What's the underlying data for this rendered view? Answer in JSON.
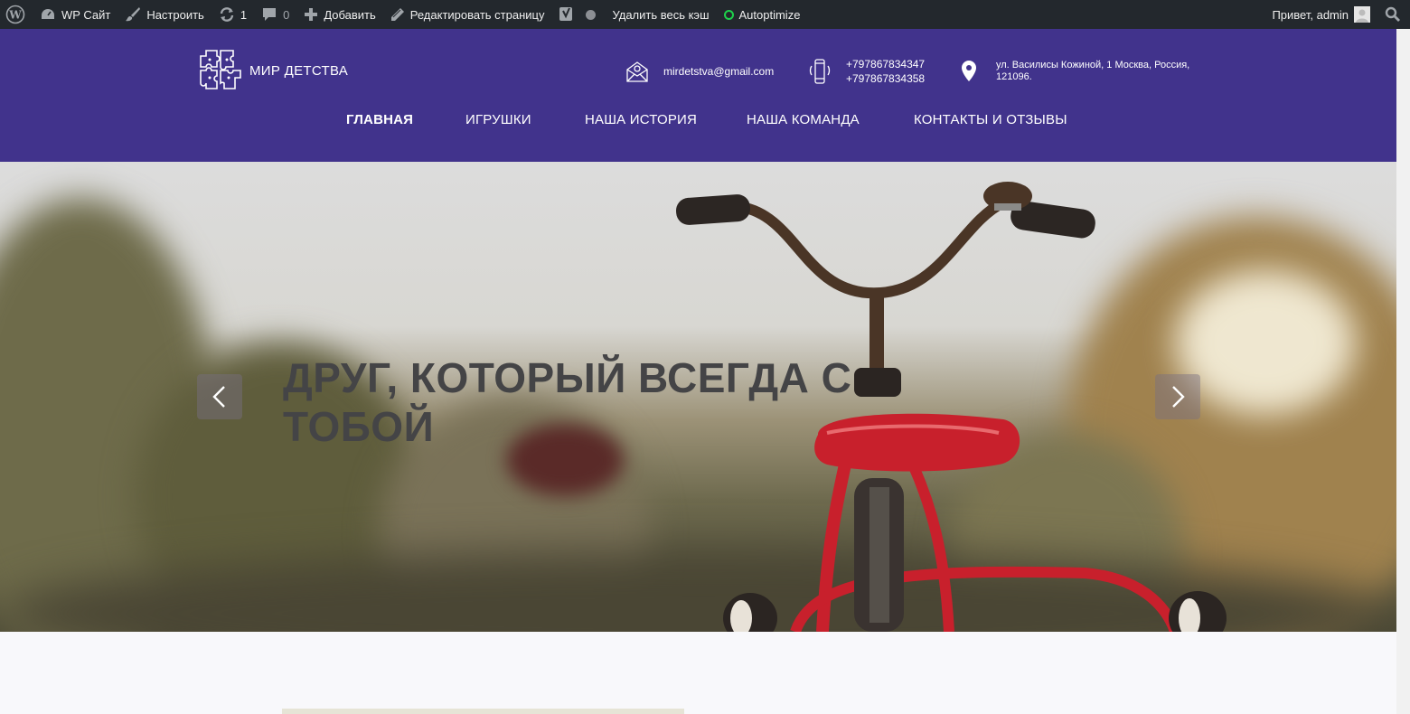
{
  "adminbar": {
    "site_name": "WP Сайт",
    "customize": "Настроить",
    "updates_count": "1",
    "comments_count": "0",
    "add_new": "Добавить",
    "edit_page": "Редактировать страницу",
    "clear_cache": "Удалить весь кэш",
    "autoptimize": "Autoptimize",
    "greeting": "Привет, admin"
  },
  "header": {
    "logo_text": "МИР ДЕТСТВА",
    "email": "mirdetstva@gmail.com",
    "phone1": "+797867834347",
    "phone2": "+797867834358",
    "address_line1": "ул. Василисы Кожиной, 1 Москва, Россия,",
    "address_line2": "121096."
  },
  "nav": {
    "items": [
      {
        "label": "Главная"
      },
      {
        "label": "Игрушки"
      },
      {
        "label": "Наша история"
      },
      {
        "label": "Наша команда"
      },
      {
        "label": "Контакты и отзывы"
      }
    ]
  },
  "hero": {
    "title_line1": "Друг, который всегда с",
    "title_line2": "тобой"
  },
  "colors": {
    "adminbar_bg": "#23282d",
    "header_bg": "#41338c",
    "hero_title": "#444446",
    "bike_red": "#c8202c"
  }
}
